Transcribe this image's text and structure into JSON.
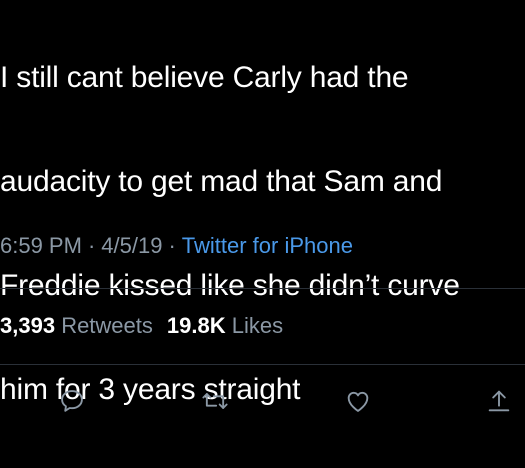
{
  "tweet": {
    "lines": [
      "I still cant believe Carly had the",
      "audacity to get mad that Sam and",
      "Freddie kissed like she didn’t curve",
      "him for 3 years straight"
    ]
  },
  "meta": {
    "time": "6:59 PM",
    "date": "4/5/19",
    "separator": "·",
    "source": "Twitter for iPhone"
  },
  "stats": {
    "retweets_count": "3,393",
    "retweets_label": "Retweets",
    "likes_count": "19.8K",
    "likes_label": "Likes"
  },
  "actions": [
    {
      "icon": "reply-icon"
    },
    {
      "icon": "retweet-icon"
    },
    {
      "icon": "like-icon"
    },
    {
      "icon": "share-icon"
    }
  ],
  "colors": {
    "background": "#000000",
    "text": "#ffffff",
    "muted": "#8b98a5",
    "link": "#4a99e9",
    "divider": "#2a3038"
  }
}
